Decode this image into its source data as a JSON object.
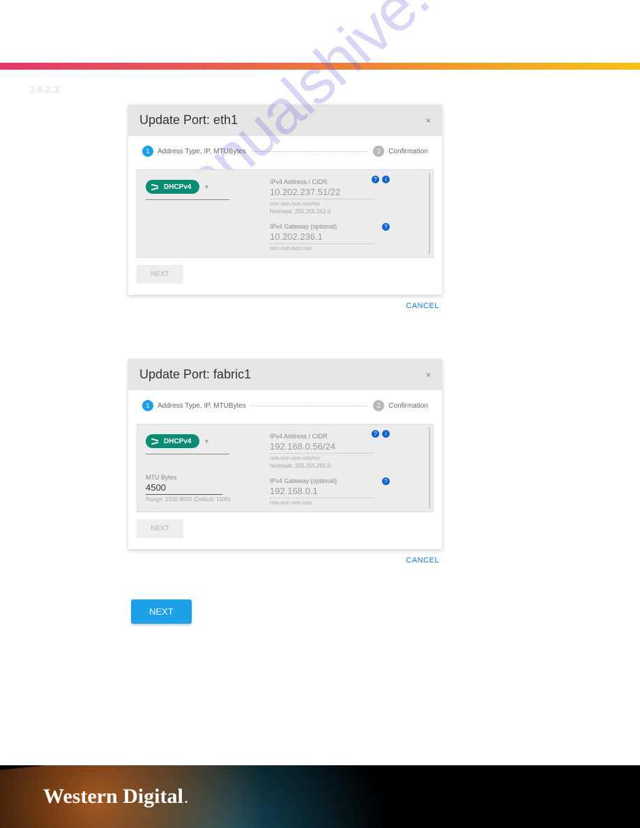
{
  "section_number": "3.6.2.3",
  "dialogs": [
    {
      "title": "Update Port: eth1",
      "step1_label": "Address Type, IP, MTUBytes",
      "step2_label": "Confirmation",
      "dhcp_pill": "DHCPv4",
      "addr_label": "IPv4 Address / CIDR",
      "addr_value": "10.202.237.51/22",
      "addr_hint": "nnn.nnn.nnn.nnn/nn",
      "netmask": "Netmask: 255.255.252.0",
      "gw_label": "IPv4 Gateway (optional)",
      "gw_value": "10.202.236.1",
      "gw_hint": "nnn.nnn.nnn.nnn",
      "next": "NEXT",
      "cancel": "CANCEL"
    },
    {
      "title": "Update Port: fabric1",
      "step1_label": "Address Type, IP, MTUBytes",
      "step2_label": "Confirmation",
      "dhcp_pill": "DHCPv4",
      "mtu_label": "MTU Bytes",
      "mtu_value": "4500",
      "mtu_hint": "Range: 1500-9000 (Default: 1500)",
      "addr_label": "IPv4 Address / CIDR",
      "addr_value": "192.168.0.56/24",
      "addr_hint": "nnn.nnn.nnn.nnn/nn",
      "netmask": "Netmask: 255.255.255.0",
      "gw_label": "IPv4 Gateway (optional)",
      "gw_value": "192.168.0.1",
      "gw_hint": "nnn.nnn.nnn.nnn",
      "next": "NEXT",
      "cancel": "CANCEL"
    }
  ],
  "primary_next": "NEXT",
  "brand": "Western Digital",
  "watermark": "manualshive.com"
}
